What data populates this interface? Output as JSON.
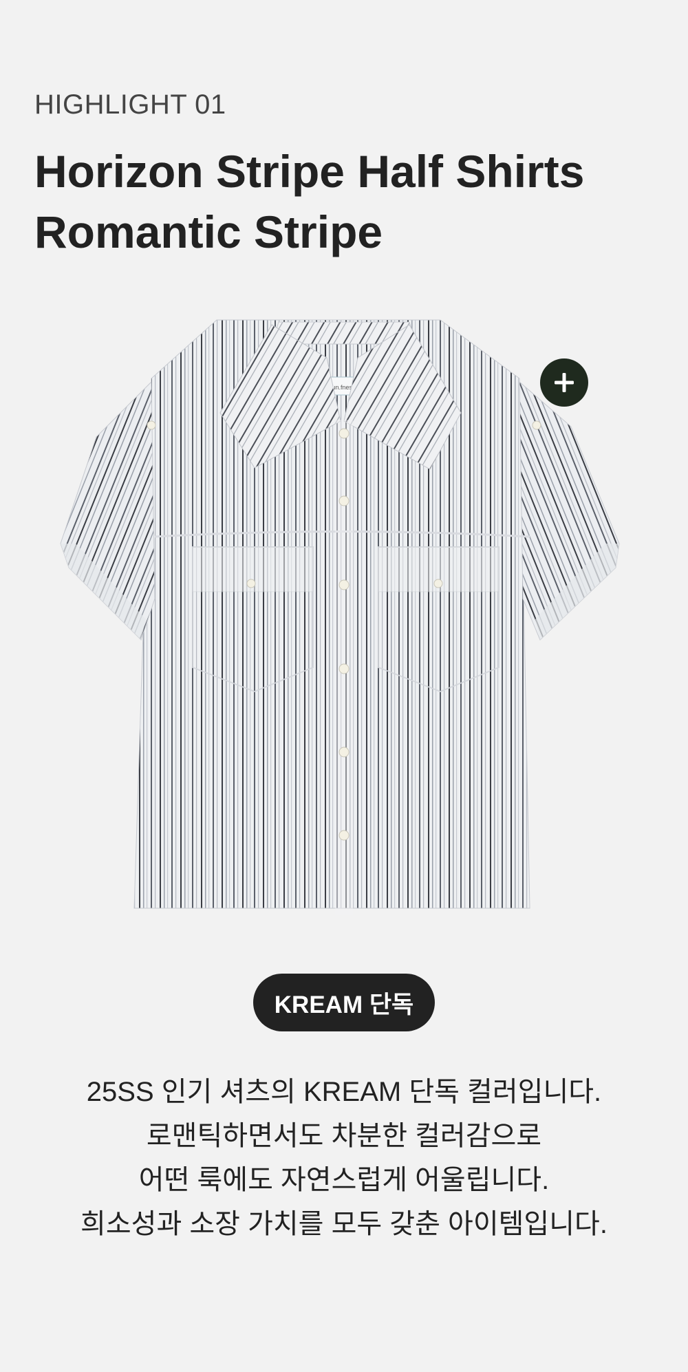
{
  "highlight": {
    "eyebrow": "HIGHLIGHT 01",
    "title_line1": "Horizon Stripe Half Shirts",
    "title_line2": "Romantic Stripe"
  },
  "product": {
    "image_icon": "striped-short-sleeve-shirt",
    "label_text": "sun.fness",
    "hotspot_icon": "plus-icon",
    "hotspot_color": "#1f2a1e"
  },
  "badge": {
    "label": "KREAM 단독"
  },
  "description": {
    "lines": [
      "25SS 인기 셔츠의 KREAM 단독 컬러입니다.",
      "로맨틱하면서도 차분한 컬러감으로",
      "어떤 룩에도 자연스럽게 어울립니다.",
      "희소성과 소장 가치를 모두 갖춘 아이템입니다."
    ]
  }
}
